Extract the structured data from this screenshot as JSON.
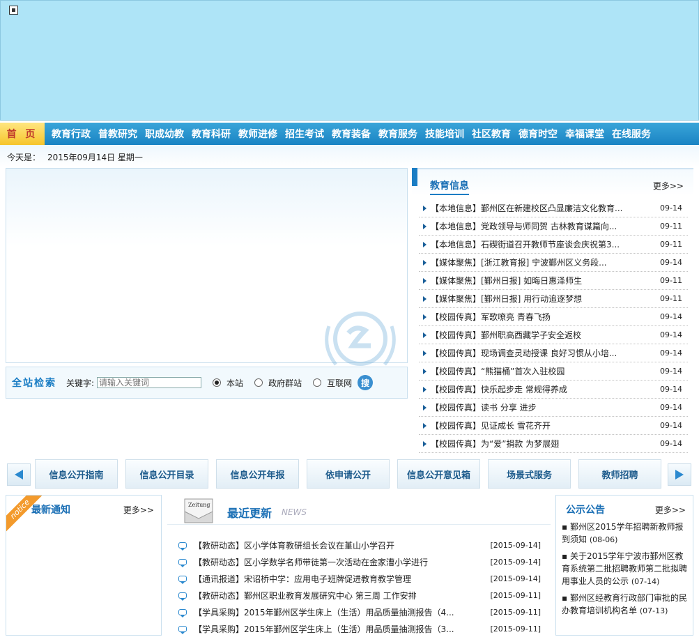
{
  "banner": {
    "plugin_icon": "flash-placeholder-icon"
  },
  "nav": {
    "home": "首 页",
    "items": [
      "教育行政",
      "普教研究",
      "职成幼教",
      "教育科研",
      "教师进修",
      "招生考试",
      "教育装备",
      "教育服务",
      "技能培训",
      "社区教育",
      "德育时空",
      "幸福课堂",
      "在线服务"
    ]
  },
  "datebar": {
    "label": "今天是：",
    "date": "2015年09月14日 星期一"
  },
  "search": {
    "title": "全站检索",
    "keyword_label": "关键字:",
    "placeholder": "请输入关键词",
    "options": [
      "本站",
      "政府群站",
      "互联网"
    ],
    "selected": "本站",
    "button": "搜"
  },
  "info": {
    "title": "教育信息",
    "more": "更多>>",
    "rows": [
      {
        "text": "【本地信息】鄞州区在新建校区凸显廉洁文化教育...",
        "date": "09-14"
      },
      {
        "text": "【本地信息】党政领导与师同贺 古林教育谋篇向...",
        "date": "09-11"
      },
      {
        "text": "【本地信息】石碶街道召开教师节座谈会庆祝第3...",
        "date": "09-11"
      },
      {
        "text": "【媒体聚焦】[浙江教育报] 宁波鄞州区义务段...",
        "date": "09-14"
      },
      {
        "text": "【媒体聚焦】[鄞州日报] 如晦日惠泽师生",
        "date": "09-11"
      },
      {
        "text": "【媒体聚焦】[鄞州日报] 用行动追逐梦想",
        "date": "09-11"
      },
      {
        "text": "【校园传真】军歌嘹亮 青春飞扬",
        "date": "09-14"
      },
      {
        "text": "【校园传真】鄞州职高西藏学子安全返校",
        "date": "09-14"
      },
      {
        "text": "【校园传真】现场调查灵动授课 良好习惯从小培...",
        "date": "09-14"
      },
      {
        "text": "【校园传真】“熊猫桶”首次入驻校园",
        "date": "09-14"
      },
      {
        "text": "【校园传真】快乐起步走 常规得养成",
        "date": "09-14"
      },
      {
        "text": "【校园传真】读书 分享 进步",
        "date": "09-14"
      },
      {
        "text": "【校园传真】见证成长 雪花齐开",
        "date": "09-14"
      },
      {
        "text": "【校园传真】为“爱”捐款 为梦展翅",
        "date": "09-14"
      }
    ]
  },
  "services": [
    "信息公开指南",
    "信息公开目录",
    "信息公开年报",
    "依申请公开",
    "信息公开意见箱",
    "场景式服务",
    "教师招聘"
  ],
  "notice": {
    "ribbon": "notice",
    "title": "最新通知",
    "more": "更多>>"
  },
  "latest": {
    "title": "最近更新",
    "subtitle": "NEWS",
    "paper_label": "Zeitung",
    "rows": [
      {
        "text": "【教研动态】区小学体育教研组长会议在堇山小学召开",
        "date": "[2015-09-14]"
      },
      {
        "text": "【教研动态】区小学数学名师带徒第一次活动在金家漕小学进行",
        "date": "[2015-09-14]"
      },
      {
        "text": "【通讯报道】宋诏桥中学：应用电子班牌促进教育教学管理",
        "date": "[2015-09-14]"
      },
      {
        "text": "【教研动态】鄞州区职业教育发展研究中心 第三周 工作安排",
        "date": "[2015-09-11]"
      },
      {
        "text": "【学具采购】2015年鄞州区学生床上（生活）用品质量抽测报告（4...",
        "date": "[2015-09-11]"
      },
      {
        "text": "【学具采购】2015年鄞州区学生床上（生活）用品质量抽测报告（3...",
        "date": "[2015-09-11]"
      }
    ]
  },
  "gonggao": {
    "title": "公示公告",
    "more": "更多>>",
    "items": [
      {
        "text": "鄞州区2015学年招聘新教师报到须知",
        "date": "(08-06)"
      },
      {
        "text": "关于2015学年宁波市鄞州区教育系统第二批招聘教师第二批拟聘用事业人员的公示",
        "date": "(07-14)"
      },
      {
        "text": "鄞州区经教育行政部门审批的民办教育培训机构名单",
        "date": "(07-13)"
      }
    ]
  }
}
